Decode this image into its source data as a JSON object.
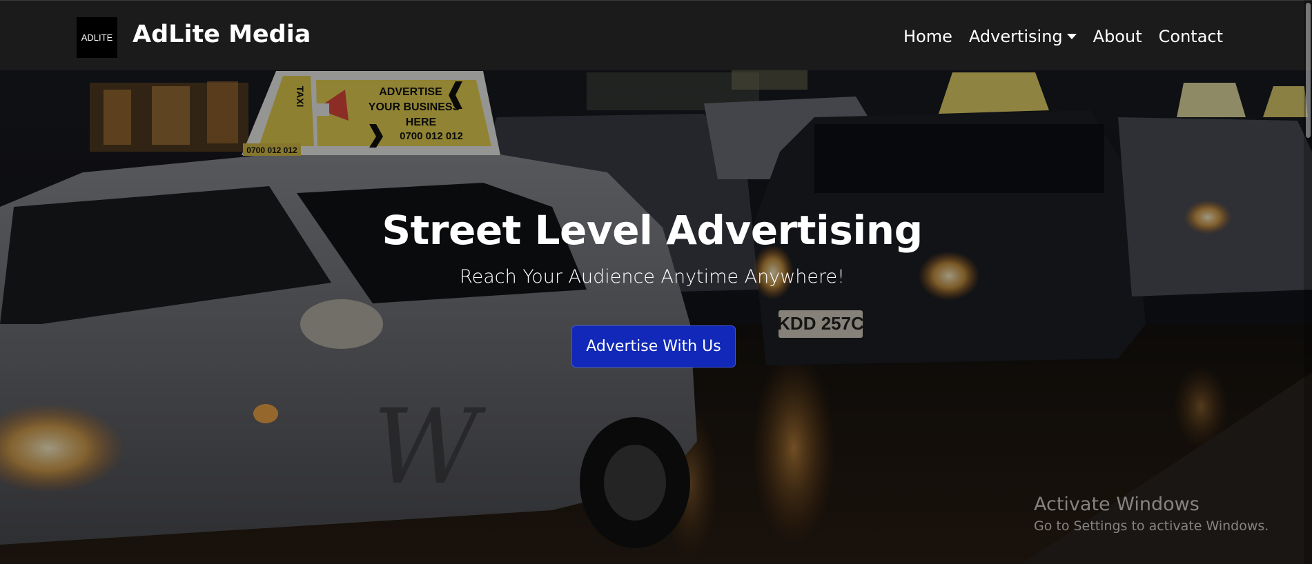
{
  "navbar": {
    "logo_text": "ADLITE",
    "brand": "AdLite Media",
    "links": [
      {
        "label": "Home"
      },
      {
        "label": "Advertising",
        "dropdown": true
      },
      {
        "label": "About"
      },
      {
        "label": "Contact"
      }
    ]
  },
  "hero": {
    "title": "Street Level Advertising",
    "subtitle": "Reach Your Audience Anytime Anywhere!",
    "cta_label": "Advertise With Us",
    "taxi_sign": {
      "side_text": "TAXI",
      "lines": [
        "ADVERTISE",
        "YOUR BUSINESS",
        "HERE"
      ],
      "phone": "0700 012 012",
      "plate_strip": "0700 012 012"
    },
    "license_plate": "KDD 257C"
  },
  "watermark": {
    "title": "Activate Windows",
    "subtitle": "Go to Settings to activate Windows."
  },
  "colors": {
    "navbar_bg": "#1c1c1c",
    "cta_bg": "#1228b8",
    "text": "#ffffff"
  },
  "icons": {
    "dropdown": "caret-down-icon"
  }
}
